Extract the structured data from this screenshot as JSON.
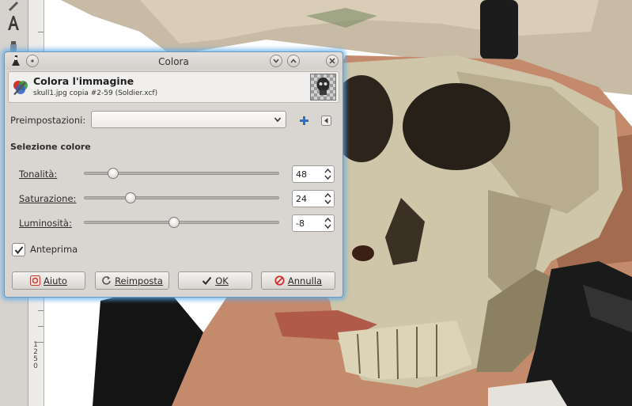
{
  "dialog": {
    "title": "Colora",
    "header_title": "Colora l'immagine",
    "header_subtitle": "skull1.jpg copia #2-59 (Soldier.xcf)",
    "presets_label": "Preimpostazioni:",
    "presets_value": "",
    "section_title": "Selezione colore",
    "sliders": [
      {
        "label": "Tonalità:",
        "value": "48",
        "fraction": 0.15
      },
      {
        "label": "Saturazione:",
        "value": "24",
        "fraction": 0.24
      },
      {
        "label": "Luminosità:",
        "value": "-8",
        "fraction": 0.46
      }
    ],
    "preview_label": "Anteprima",
    "preview_checked": true,
    "buttons": {
      "help": "Aiuto",
      "reset": "Reimposta",
      "ok": "OK",
      "cancel": "Annulla"
    }
  },
  "ruler": {
    "numbers": "1\n2\n5\n0"
  },
  "icons": {
    "dialog": "gimp-wilber-icon",
    "colorize": "color-palette-icon",
    "add_preset": "plus-icon",
    "preset_menu": "triangle-left-icon"
  },
  "colors": {
    "accent_glow": "#5aaaeb",
    "plus": "#2f6fc7",
    "cancel_red": "#d0312d"
  }
}
